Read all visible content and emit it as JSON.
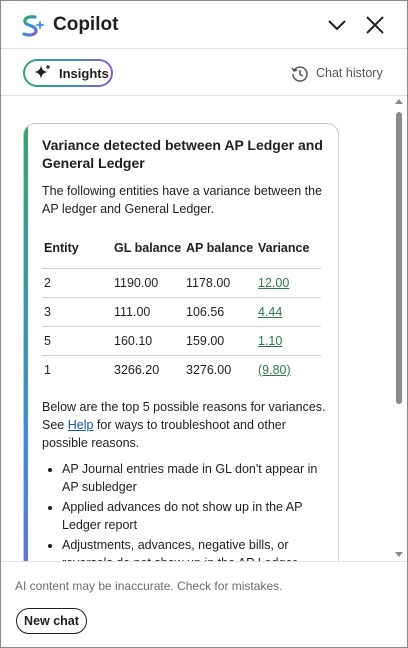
{
  "header": {
    "title": "Copilot",
    "logo_icon": "copilot-logo-icon",
    "collapse_icon": "chevron-down-icon",
    "close_icon": "close-icon"
  },
  "toolbar": {
    "insights_label": "Insights",
    "insights_icon": "sparkle-icon",
    "history_label": "Chat history",
    "history_icon": "history-clock-icon"
  },
  "card": {
    "title": "Variance detected between AP Ledger and General Ledger",
    "intro": "The following entities have a variance between the AP ledger and General Ledger.",
    "table": {
      "headers": [
        "Entity",
        "GL balance",
        "AP balance",
        "Variance"
      ],
      "rows": [
        [
          "2",
          "1190.00",
          "1178.00",
          "12.00"
        ],
        [
          "3",
          "111.00",
          "106.56",
          "4.44"
        ],
        [
          "5",
          "160.10",
          "159.00",
          "1.10"
        ],
        [
          "1",
          "3266.20",
          "3276.00",
          "(9.80)"
        ]
      ]
    },
    "reasons": {
      "line1": "Below are the top 5 possible reasons for variances.",
      "see": "See ",
      "help_link": "Help",
      "rest": " for ways to troubleshoot and other possible reasons."
    },
    "bullets": [
      "AP Journal entries made in GL don't appear in AP subledger",
      "Applied advances do not show up in the AP Ledger report",
      "Adjustments, advances, negative bills, or reversals do not show up in the AP Ledger report or the GL"
    ]
  },
  "footer": {
    "disclaimer": "AI content may be inaccurate. Check for mistakes.",
    "new_chat_label": "New chat"
  },
  "colors": {
    "accent_green": "#2fa86a",
    "accent_blue": "#3b8ce0",
    "accent_purple": "#8e5ad8",
    "link_green": "#2b7a4b",
    "link_blue": "#1557b0"
  }
}
